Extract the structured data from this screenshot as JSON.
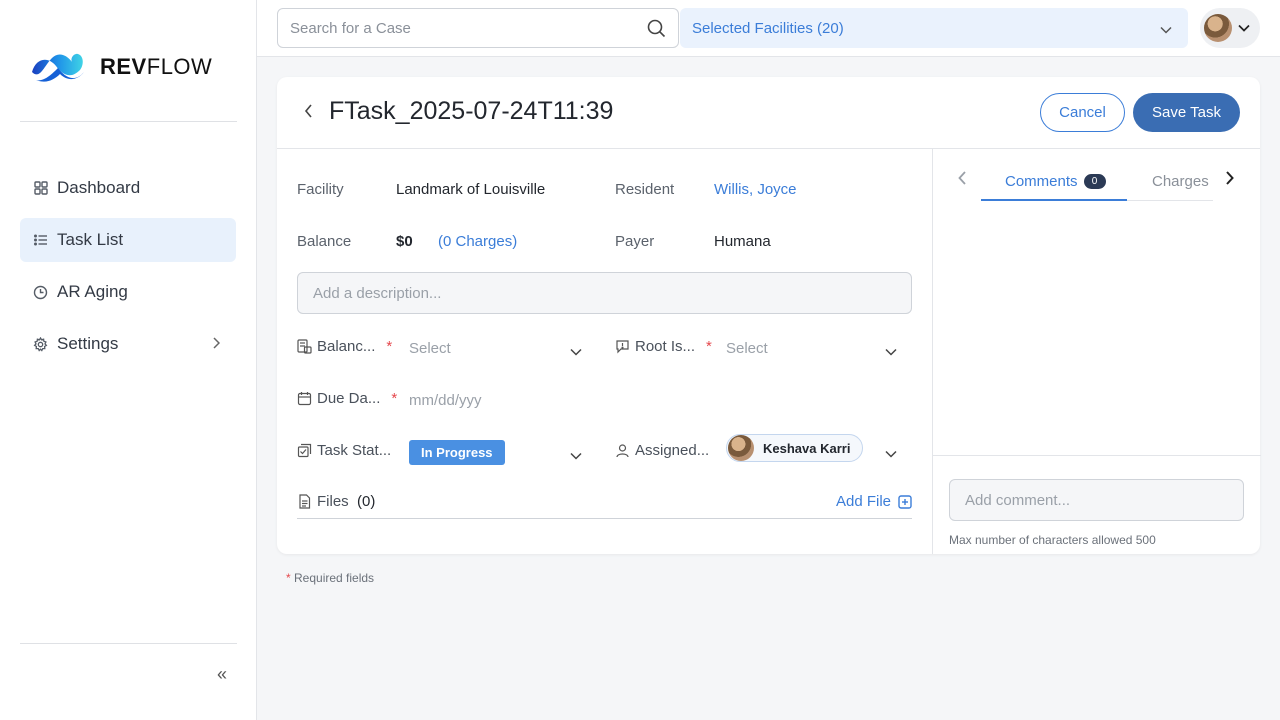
{
  "brand": {
    "name_bold": "REV",
    "name_rest": "FLOW"
  },
  "sidebar": {
    "items": [
      {
        "label": "Dashboard",
        "icon": "grid-icon",
        "active": false
      },
      {
        "label": "Task List",
        "icon": "list-icon",
        "active": true
      },
      {
        "label": "AR Aging",
        "icon": "clock-icon",
        "active": false
      },
      {
        "label": "Settings",
        "icon": "gear-icon",
        "active": false
      }
    ],
    "collapse_glyph": "«"
  },
  "topbar": {
    "search_placeholder": "Search for a Case",
    "facilities_label": "Selected Facilities (20)"
  },
  "task": {
    "title": "FTask_2025-07-24T11:39",
    "cancel_label": "Cancel",
    "save_label": "Save Task",
    "facility_label": "Facility",
    "facility_value": "Landmark of Louisville",
    "resident_label": "Resident",
    "resident_value": "Willis, Joyce",
    "balance_label": "Balance",
    "balance_value": "$0",
    "charges_link": "(0 Charges)",
    "payer_label": "Payer",
    "payer_value": "Humana",
    "description_placeholder": "Add a description...",
    "fields": {
      "balance_type_label": "Balanc...",
      "balance_type_value": "Select",
      "root_issue_label": "Root Is...",
      "root_issue_value": "Select",
      "due_date_label": "Due Da...",
      "due_date_value": "mm/dd/yyy",
      "task_status_label": "Task Stat...",
      "task_status_value": "In Progress",
      "assigned_label": "Assigned...",
      "assigned_value": "Keshava Karri",
      "required_mark": "*"
    },
    "files_label": "Files",
    "files_count": "(0)",
    "add_file_label": "Add File"
  },
  "panel": {
    "tab_comments": "Comments",
    "comments_count": "0",
    "tab_charges": "Charges",
    "comment_placeholder": "Add comment...",
    "char_limit_hint": "Max number of characters allowed 500"
  },
  "footer": {
    "required_note": "Required fields",
    "required_star": "*"
  },
  "colors": {
    "accent": "#3b7dd8",
    "primary_button": "#3a6db3",
    "status_badge": "#4a90e2",
    "required": "#e5484d"
  }
}
